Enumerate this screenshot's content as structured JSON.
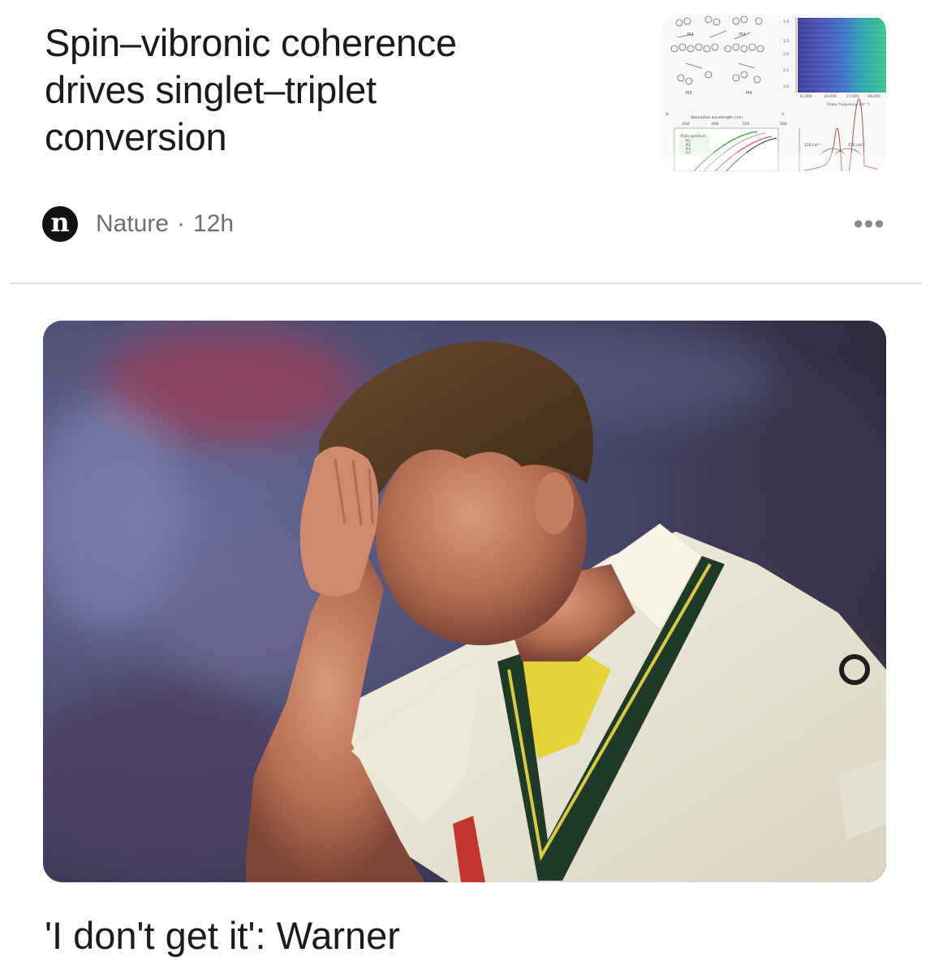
{
  "articles": [
    {
      "headline_lines": [
        "Spin–vibronic coherence",
        "drives singlet–triplet",
        "conversion"
      ],
      "thumbnail_icon": "scientific-figure-thumbnail",
      "source": {
        "logo_letter": "n",
        "name": "Nature",
        "separator": "·",
        "time_ago": "12h"
      },
      "more_label": "•••"
    },
    {
      "image_icon": "cricket-player-photo",
      "headline": "'I don't get it': Warner"
    }
  ],
  "colors": {
    "background": "#ffffff",
    "headline_text": "#1b1b1b",
    "meta_text": "#6f6f73",
    "divider": "#e1e1e6"
  }
}
